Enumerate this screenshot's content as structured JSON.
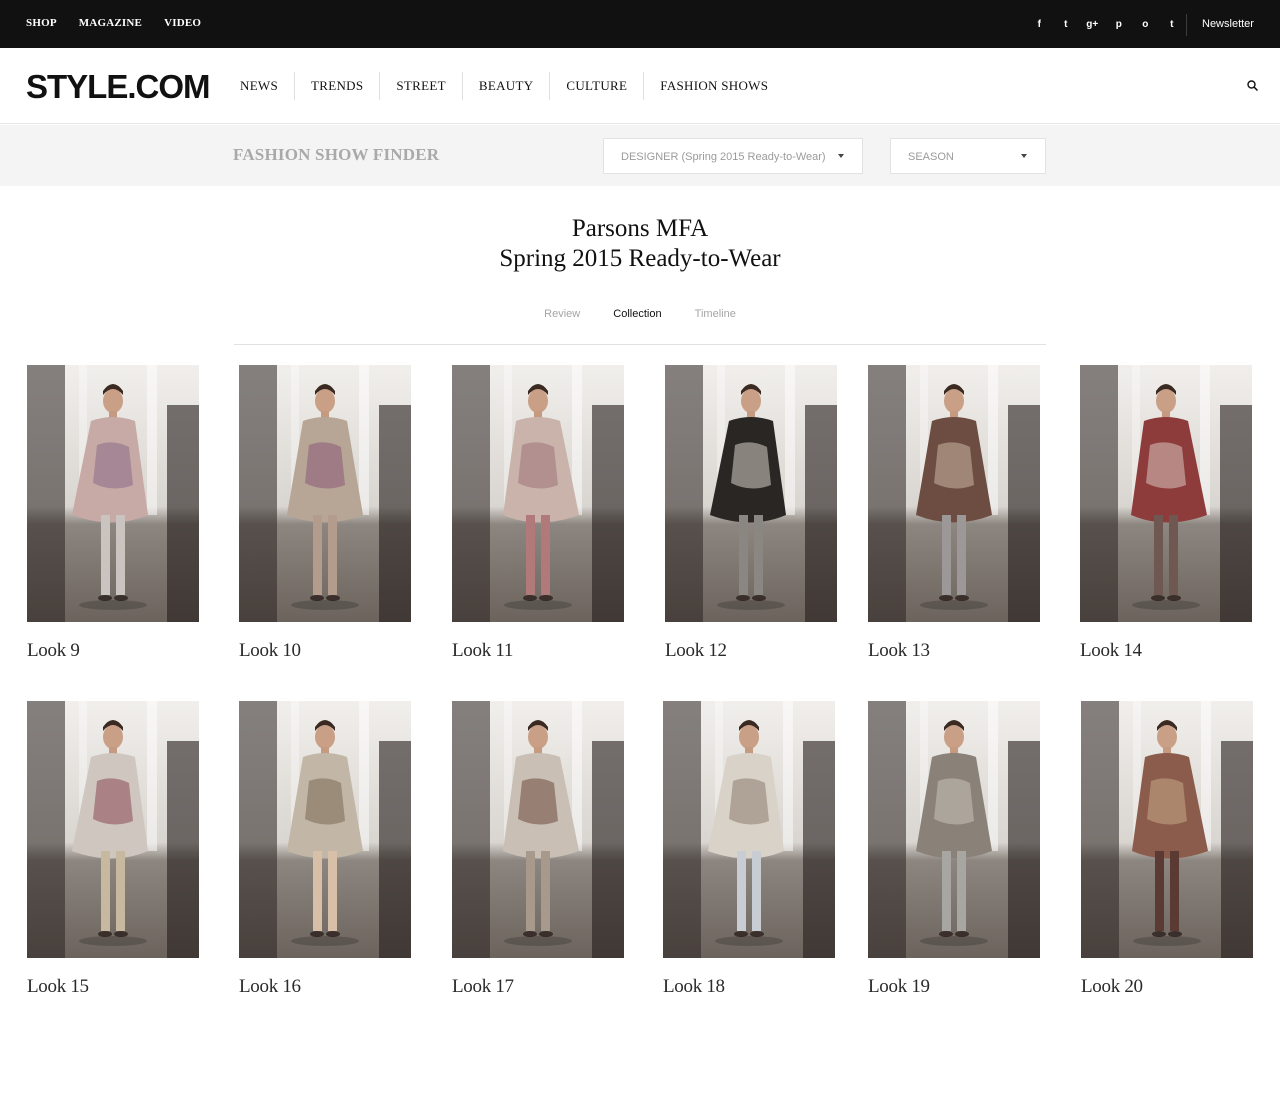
{
  "topbar": {
    "nav": [
      "SHOP",
      "MAGAZINE",
      "VIDEO"
    ],
    "social_icons": [
      "facebook-icon",
      "twitter-icon",
      "google-plus-icon",
      "pinterest-icon",
      "instagram-icon",
      "tumblr-icon"
    ],
    "social_glyphs": [
      "f",
      "t",
      "g+",
      "p",
      "o",
      "t"
    ],
    "newsletter": "Newsletter"
  },
  "header": {
    "logo": "STYLE.COM",
    "nav": [
      "NEWS",
      "TRENDS",
      "STREET",
      "BEAUTY",
      "CULTURE",
      "FASHION SHOWS"
    ]
  },
  "finder": {
    "title": "FASHION SHOW FINDER",
    "designer_label": "DESIGNER (Spring 2015 Ready-to-Wear)",
    "season_label": "SEASON"
  },
  "show": {
    "designer": "Parsons MFA",
    "season": "Spring 2015 Ready-to-Wear",
    "tabs": [
      {
        "label": "Review",
        "active": false
      },
      {
        "label": "Collection",
        "active": true
      },
      {
        "label": "Timeline",
        "active": false
      }
    ]
  },
  "looks": [
    {
      "label": "Look 9",
      "outfit": "#c7a9a6",
      "accent": "#8b6b88",
      "legs": "#c9c4c0"
    },
    {
      "label": "Look 10",
      "outfit": "#b7a595",
      "accent": "#8a5a78",
      "legs": "#b49c8c"
    },
    {
      "label": "Look 11",
      "outfit": "#c9b3aa",
      "accent": "#a0727a",
      "legs": "#b07a7a"
    },
    {
      "label": "Look 12",
      "outfit": "#2a2624",
      "accent": "#d6d0c7",
      "legs": "#8a8682"
    },
    {
      "label": "Look 13",
      "outfit": "#6d4d42",
      "accent": "#c8b6a2",
      "legs": "#9b9897"
    },
    {
      "label": "Look 14",
      "outfit": "#8e3b3b",
      "accent": "#d9c8bf",
      "legs": "#6f5852"
    },
    {
      "label": "Look 15",
      "outfit": "#cfc6bf",
      "accent": "#8c4a55",
      "legs": "#c7b9a0"
    },
    {
      "label": "Look 16",
      "outfit": "#c2b6a6",
      "accent": "#7b6a54",
      "legs": "#d8bfa8"
    },
    {
      "label": "Look 17",
      "outfit": "#c9bfb5",
      "accent": "#6e4c3c",
      "legs": "#a79a8c"
    },
    {
      "label": "Look 18",
      "outfit": "#d9d2c8",
      "accent": "#8b7c6e",
      "legs": "#c8cdd3"
    },
    {
      "label": "Look 19",
      "outfit": "#8a8178",
      "accent": "#c9c3b8",
      "legs": "#a8a6a2"
    },
    {
      "label": "Look 20",
      "outfit": "#8b5b4b",
      "accent": "#c7a98b",
      "legs": "#5a3a32"
    }
  ]
}
